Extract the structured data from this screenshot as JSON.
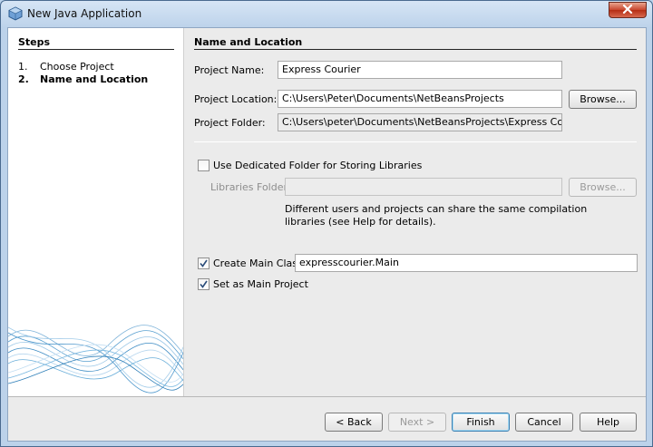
{
  "window": {
    "title": "New Java Application"
  },
  "steps": {
    "heading": "Steps",
    "items": [
      {
        "num": "1.",
        "label": "Choose Project",
        "current": false
      },
      {
        "num": "2.",
        "label": "Name and Location",
        "current": true
      }
    ]
  },
  "form": {
    "heading": "Name and Location",
    "project_name_label": "Project Name:",
    "project_name_value": "Express Courier",
    "project_location_label": "Project Location:",
    "project_location_value": "C:\\Users\\Peter\\Documents\\NetBeansProjects",
    "browse_label": "Browse...",
    "project_folder_label": "Project Folder:",
    "project_folder_value": "C:\\Users\\peter\\Documents\\NetBeansProjects\\Express Courier",
    "dedicated_folder_label": "Use Dedicated Folder for Storing Libraries",
    "dedicated_folder_checked": false,
    "libraries_folder_label": "Libraries Folder:",
    "libraries_folder_value": "",
    "libraries_browse_label": "Browse...",
    "help_line1": "Different users and projects can share the same compilation",
    "help_line2": "libraries (see Help for details).",
    "create_main_class_label": "Create Main Class",
    "create_main_class_checked": true,
    "main_class_value": "expresscourier.Main",
    "set_main_project_label": "Set as Main Project",
    "set_main_project_checked": true
  },
  "buttons": {
    "back": "< Back",
    "next": "Next >",
    "finish": "Finish",
    "cancel": "Cancel",
    "help": "Help"
  },
  "icons": {
    "app": "netbeans-cube-icon",
    "close": "close-icon",
    "check": "checkmark-icon"
  }
}
